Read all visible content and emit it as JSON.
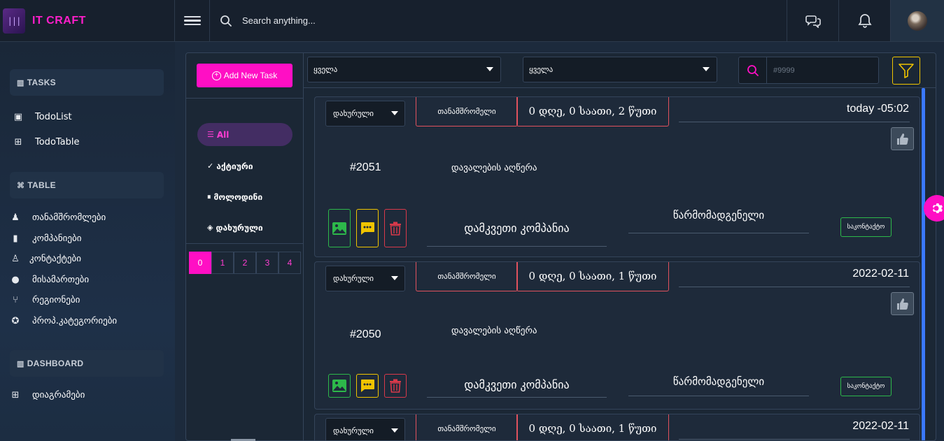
{
  "app": {
    "brand_name": "IT CRAFT",
    "search_placeholder": "Search anything..."
  },
  "sidebar": {
    "sections": [
      {
        "title": "TASKS",
        "icon": "bar-chart-icon",
        "items": [
          {
            "label": "TodoList",
            "icon": "list-box-icon"
          },
          {
            "label": "TodoTable",
            "icon": "table-grid-icon"
          }
        ]
      },
      {
        "title": "TABLE",
        "icon": "sitemap-icon",
        "items": [
          {
            "label": "თანამშრომლები",
            "icon": "user-icon"
          },
          {
            "label": "კომპანიები",
            "icon": "building-icon"
          },
          {
            "label": "კონტაქტები",
            "icon": "contacts-icon"
          },
          {
            "label": "მისამართები",
            "icon": "location-pin-icon"
          },
          {
            "label": "რეგიონები",
            "icon": "branch-icon"
          },
          {
            "label": "პროპ.კატეგორიები",
            "icon": "categories-icon"
          }
        ]
      },
      {
        "title": "DASHBOARD",
        "icon": "bar-chart-icon",
        "items": [
          {
            "label": "დიაგრამები",
            "icon": "grid-icon"
          }
        ]
      }
    ]
  },
  "panel": {
    "add_task_label": "Add New Task",
    "filters": [
      {
        "label": "All",
        "icon": "list-icon",
        "active": true
      },
      {
        "label": "აქტიური",
        "icon": "check-circle-icon",
        "active": false
      },
      {
        "label": "მოლოდინი",
        "icon": "pause-icon",
        "active": false
      },
      {
        "label": "დახურული",
        "icon": "layers-icon",
        "active": false
      }
    ],
    "pages": [
      "0",
      "1",
      "2",
      "3",
      "4"
    ],
    "active_page": "0",
    "select_one_value": "ყველა",
    "select_two_value": "ყველა",
    "id_search_placeholder": "#9999"
  },
  "tasks": [
    {
      "status": "დახურული",
      "employee": "თანამშრომელი",
      "duration": "0 დღე, 0 საათი, 2 წუთი",
      "date": "today -05:02",
      "number": "#2051",
      "description": "დავალების აღწერა",
      "company": "დამკვეთი კომპანია",
      "representative": "წარმომადგენელი",
      "contact_label": "საკონტაქტო"
    },
    {
      "status": "დახურული",
      "employee": "თანამშრომელი",
      "duration": "0 დღე, 0 საათი, 1 წუთი",
      "date": "2022-02-11",
      "number": "#2050",
      "description": "დავალების აღწერა",
      "company": "დამკვეთი კომპანია",
      "representative": "წარმომადგენელი",
      "contact_label": "საკონტაქტო"
    },
    {
      "status": "დახურული",
      "employee": "თანამშრომელი",
      "duration": "0 დღე, 0 საათი, 1 წუთი",
      "date": "2022-02-11"
    }
  ],
  "colors": {
    "accent": "#ff0fc4",
    "brand_text": "#ff1ecb",
    "danger": "#e0525e",
    "success": "#2db84a",
    "warning": "#f0c400",
    "scroll_thumb": "#3a78ff"
  }
}
